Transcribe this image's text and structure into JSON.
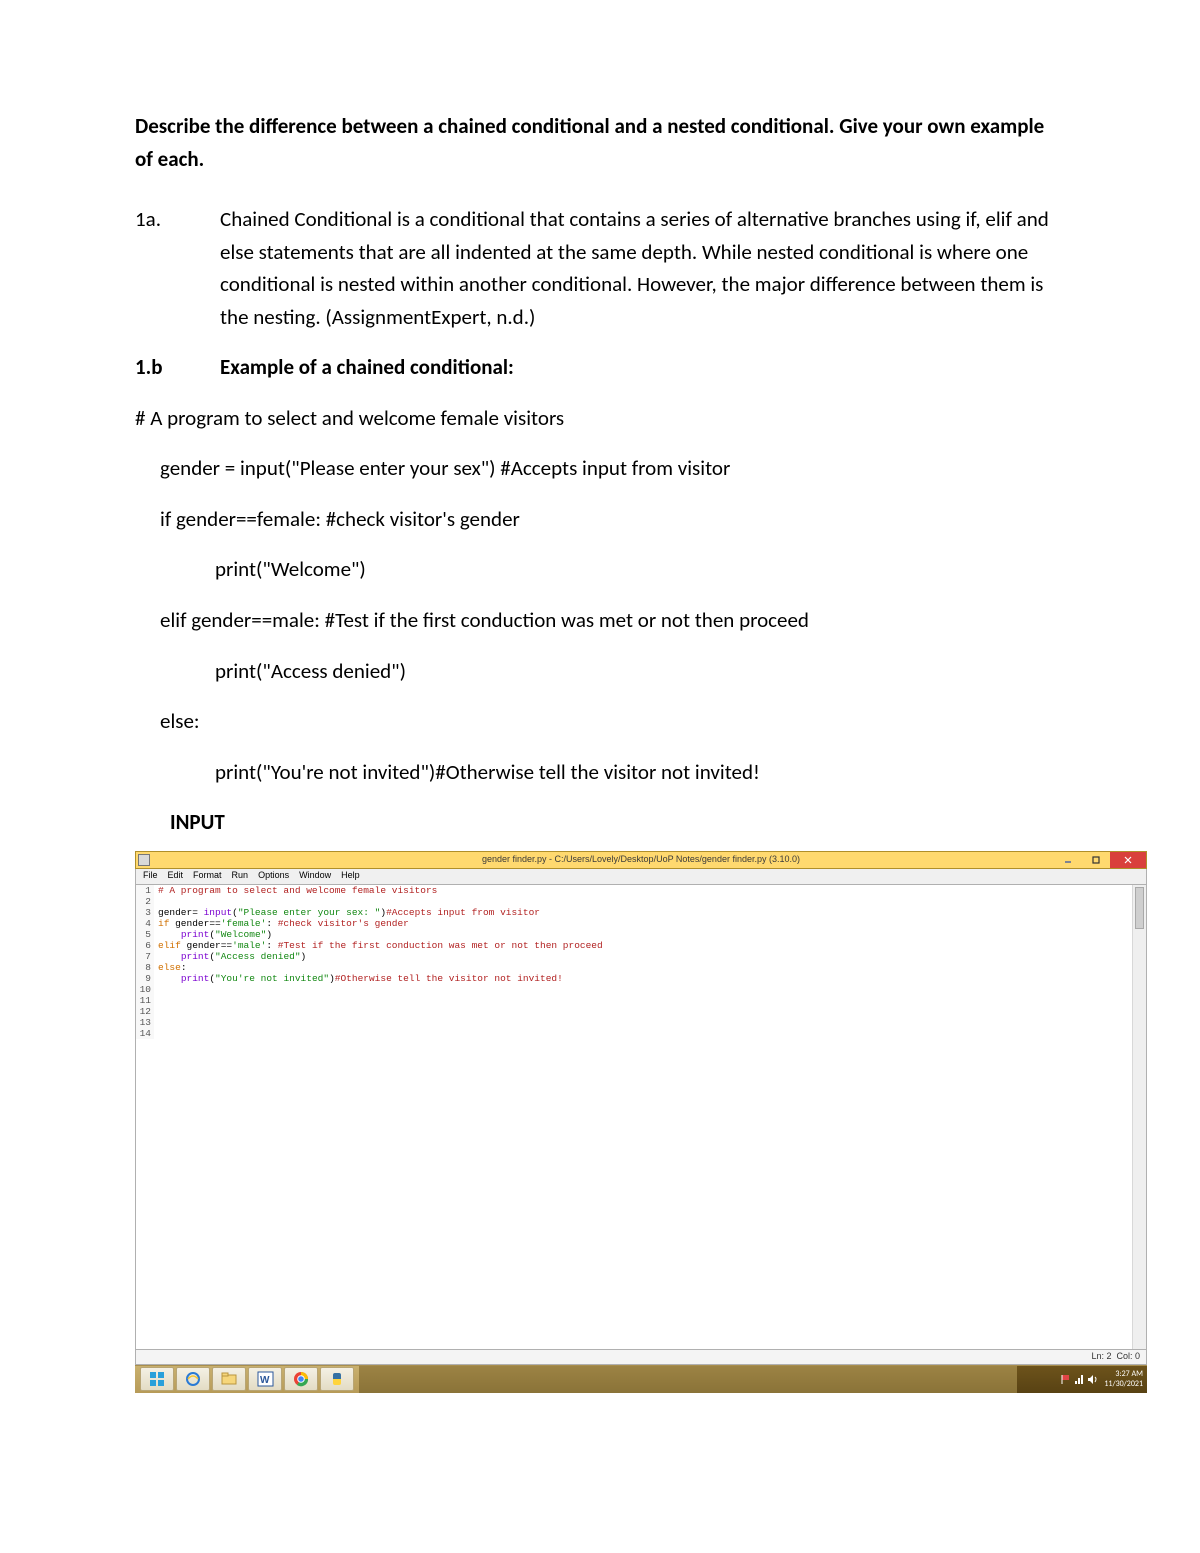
{
  "question": "Describe the difference between a chained conditional and a nested conditional. Give your own example of each.",
  "a1": {
    "num": "1a.",
    "text": "Chained Conditional is a conditional that contains a series of alternative branches using if, elif and else statements that are all indented at the same depth. While nested conditional is where one conditional is nested within another conditional. However, the major difference between them is the nesting. (AssignmentExpert, n.d.)"
  },
  "b1": {
    "num": "1.b",
    "title": "Example of a chained conditional:"
  },
  "code": {
    "intro": "# A program to select and welcome female visitors",
    "l1": "gender = input(\"Please enter your sex\") #Accepts input from visitor",
    "l2": "if gender==female: #check visitor's gender",
    "l3": "print(\"Welcome\")",
    "l4": "elif gender==male: #Test if the first conduction was met or not then proceed",
    "l5": "print(\"Access denied\")",
    "l6": "else:",
    "l7": "print(\"You're not invited\")#Otherwise tell the visitor not invited!"
  },
  "input_heading": "INPUT",
  "idle": {
    "title": "gender finder.py - C:/Users/Lovely/Desktop/UoP Notes/gender finder.py (3.10.0)",
    "menus": [
      "File",
      "Edit",
      "Format",
      "Run",
      "Options",
      "Window",
      "Help"
    ],
    "status": {
      "ln": "Ln: 2",
      "col": "Col: 0"
    },
    "lines": [
      {
        "n": "1",
        "segments": [
          {
            "cls": "c-comment",
            "t": "# A program to select and welcome female visitors"
          }
        ]
      },
      {
        "n": "2",
        "segments": [
          {
            "cls": "c-plain",
            "t": ""
          }
        ]
      },
      {
        "n": "3",
        "segments": [
          {
            "cls": "c-plain",
            "t": "gender= "
          },
          {
            "cls": "c-fn",
            "t": "input"
          },
          {
            "cls": "c-plain",
            "t": "("
          },
          {
            "cls": "c-str",
            "t": "\"Please enter your sex: \""
          },
          {
            "cls": "c-plain",
            "t": ")"
          },
          {
            "cls": "c-comment",
            "t": "#Accepts input from visitor"
          }
        ]
      },
      {
        "n": "4",
        "segments": [
          {
            "cls": "c-kw",
            "t": "if"
          },
          {
            "cls": "c-plain",
            "t": " gender=="
          },
          {
            "cls": "c-str",
            "t": "'female'"
          },
          {
            "cls": "c-plain",
            "t": ": "
          },
          {
            "cls": "c-comment",
            "t": "#check visitor's gender"
          }
        ]
      },
      {
        "n": "5",
        "segments": [
          {
            "cls": "c-plain",
            "t": "    "
          },
          {
            "cls": "c-fn",
            "t": "print"
          },
          {
            "cls": "c-plain",
            "t": "("
          },
          {
            "cls": "c-str",
            "t": "\"Welcome\""
          },
          {
            "cls": "c-plain",
            "t": ")"
          }
        ]
      },
      {
        "n": "6",
        "segments": [
          {
            "cls": "c-kw",
            "t": "elif"
          },
          {
            "cls": "c-plain",
            "t": " gender=="
          },
          {
            "cls": "c-str",
            "t": "'male'"
          },
          {
            "cls": "c-plain",
            "t": ": "
          },
          {
            "cls": "c-comment",
            "t": "#Test if the first conduction was met or not then proceed"
          }
        ]
      },
      {
        "n": "7",
        "segments": [
          {
            "cls": "c-plain",
            "t": "    "
          },
          {
            "cls": "c-fn",
            "t": "print"
          },
          {
            "cls": "c-plain",
            "t": "("
          },
          {
            "cls": "c-str",
            "t": "\"Access denied\""
          },
          {
            "cls": "c-plain",
            "t": ")"
          }
        ]
      },
      {
        "n": "8",
        "segments": [
          {
            "cls": "c-kw",
            "t": "else"
          },
          {
            "cls": "c-plain",
            "t": ":"
          }
        ]
      },
      {
        "n": "9",
        "segments": [
          {
            "cls": "c-plain",
            "t": "    "
          },
          {
            "cls": "c-fn",
            "t": "print"
          },
          {
            "cls": "c-plain",
            "t": "("
          },
          {
            "cls": "c-str",
            "t": "\"You're not invited\""
          },
          {
            "cls": "c-plain",
            "t": ")"
          },
          {
            "cls": "c-comment",
            "t": "#Otherwise tell the visitor not invited!"
          }
        ]
      },
      {
        "n": "10",
        "segments": []
      },
      {
        "n": "11",
        "segments": []
      },
      {
        "n": "12",
        "segments": []
      },
      {
        "n": "13",
        "segments": []
      },
      {
        "n": "14",
        "segments": []
      }
    ]
  },
  "taskbar": {
    "clock_time": "3:27 AM",
    "clock_date": "11/30/2021"
  }
}
